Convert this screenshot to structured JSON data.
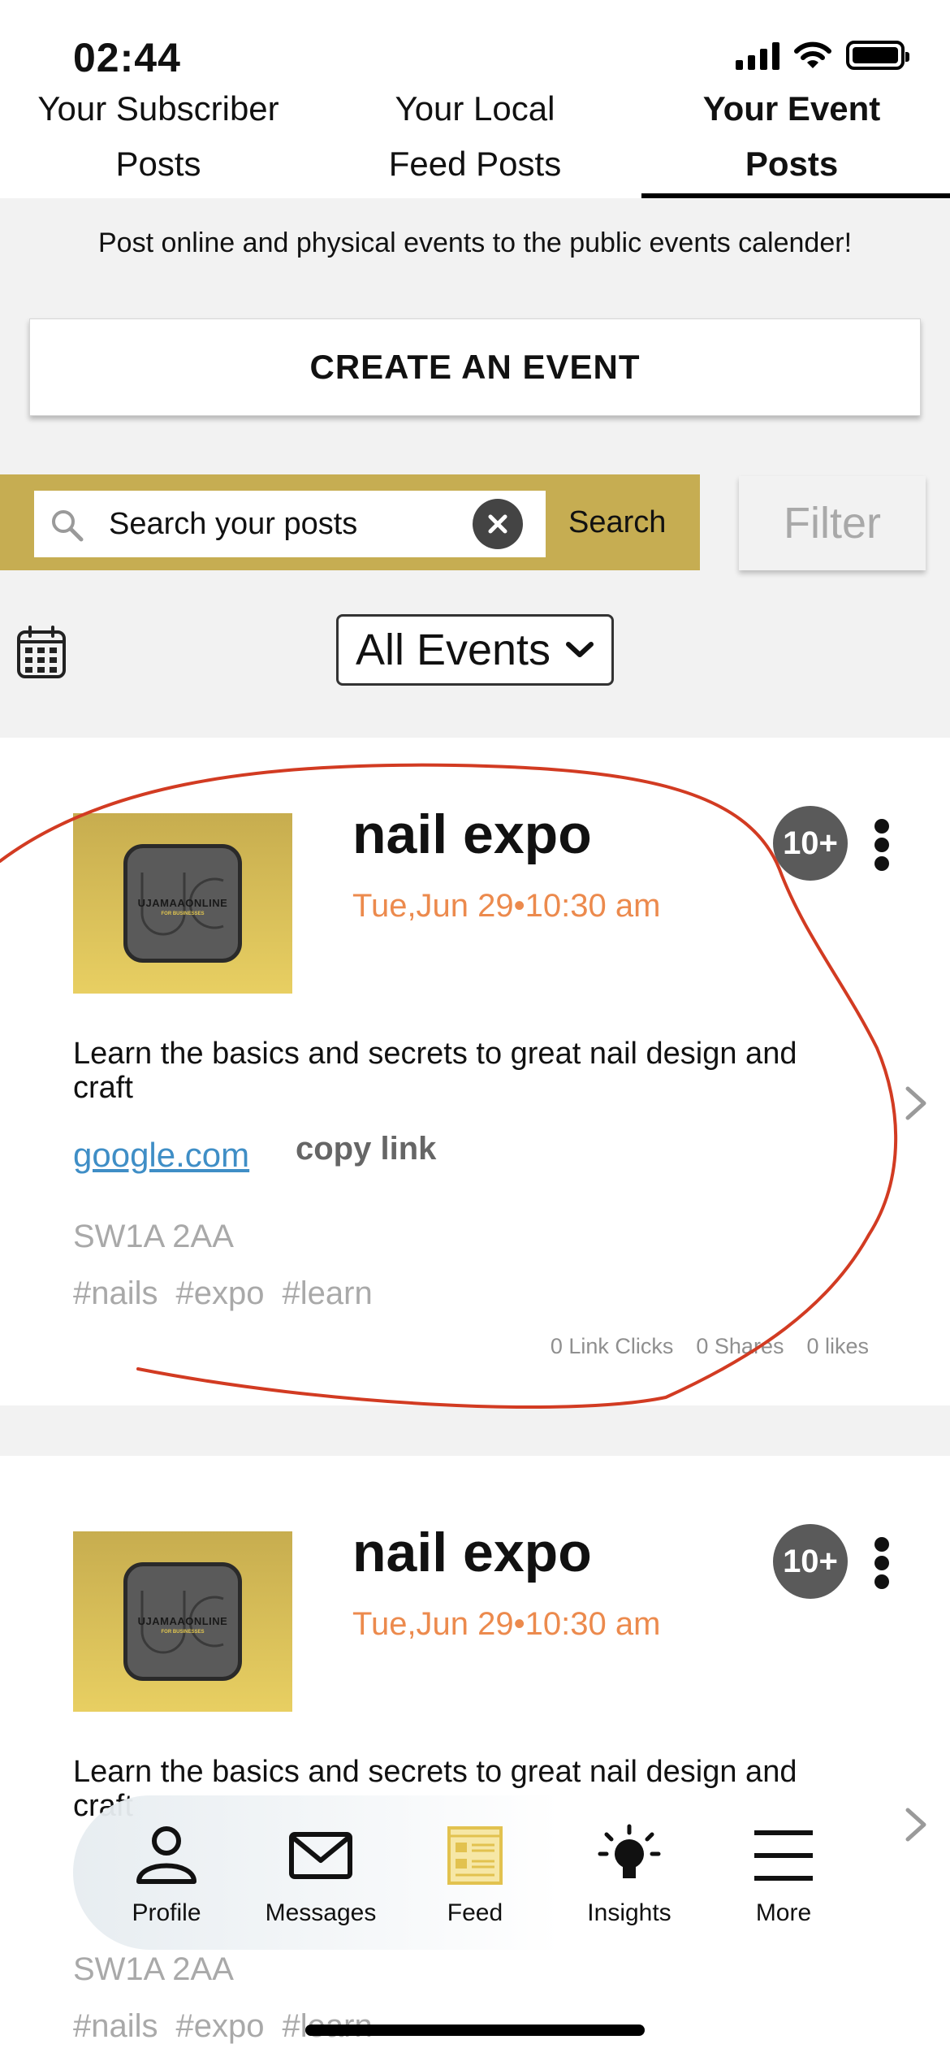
{
  "status_bar": {
    "time": "02:44"
  },
  "tabs": [
    {
      "line1": "Your Subscriber",
      "line2": "Posts",
      "active": false
    },
    {
      "line1": "Your Local",
      "line2": "Feed Posts",
      "active": false
    },
    {
      "line1": "Your Event",
      "line2": "Posts",
      "active": true
    }
  ],
  "info_text": "Post online and physical events to the public events calender!",
  "create_button": "CREATE AN EVENT",
  "search": {
    "placeholder": "Search your posts",
    "value": "Search your posts",
    "button": "Search"
  },
  "filter_button": "Filter",
  "events_dropdown": {
    "selected": "All Events"
  },
  "posts": [
    {
      "logo_text": "UJAMAAONLINE",
      "logo_sub": "FOR BUSINESSES",
      "title": "nail expo",
      "date": "Tue,Jun 29•10:30 am",
      "badge": "10+",
      "description": "Learn the basics and secrets to great nail design and craft",
      "link": "google.com",
      "copy_link": "copy link",
      "postcode": "SW1A 2AA",
      "tags": [
        "#nails",
        "#expo",
        "#learn"
      ],
      "stats": {
        "link_clicks": "0 Link Clicks",
        "shares": "0 Shares",
        "likes": "0 likes"
      }
    },
    {
      "logo_text": "UJAMAAONLINE",
      "logo_sub": "FOR BUSINESSES",
      "title": "nail expo",
      "date": "Tue,Jun 29•10:30 am",
      "badge": "10+",
      "description": "Learn the basics and secrets to great nail design and craft",
      "postcode": "SW1A 2AA",
      "tags": [
        "#nails",
        "#expo",
        "#learn"
      ]
    }
  ],
  "bottom_nav": [
    {
      "label": "Profile",
      "icon": "person-icon"
    },
    {
      "label": "Messages",
      "icon": "envelope-icon"
    },
    {
      "label": "Feed",
      "icon": "feed-icon"
    },
    {
      "label": "Insights",
      "icon": "lightbulb-icon"
    },
    {
      "label": "More",
      "icon": "hamburger-icon"
    }
  ],
  "colors": {
    "accent_gold": "#c6ad52",
    "date_orange": "#ec8a4d",
    "link_blue": "#3f8ec6",
    "annotation_red": "#d23b22"
  }
}
